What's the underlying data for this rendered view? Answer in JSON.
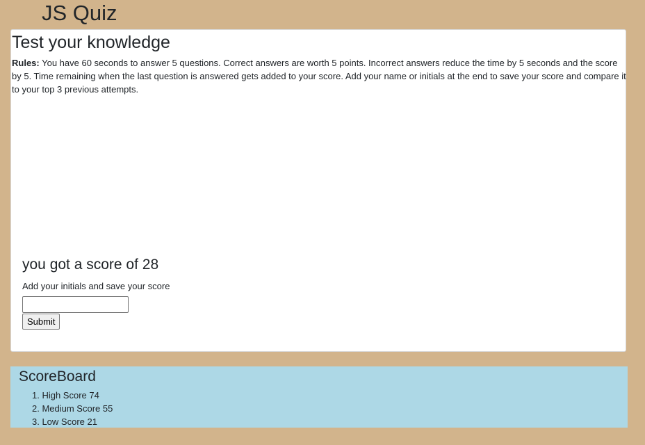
{
  "app": {
    "title": "JS Quiz"
  },
  "quiz": {
    "heading": "Test your knowledge",
    "rules_label": "Rules:",
    "rules_text": " You have 60 seconds to answer 5 questions. Correct answers are worth 5 points. Incorrect answers reduce the time by 5 seconds and the score by 5. Time remaining when the last question is answered gets added to your score. Add your name or initials at the end to save your score and compare it to your top 3 previous attempts."
  },
  "result": {
    "score_text": "you got a score of 28",
    "initials_label": "Add your initials and save your score",
    "initials_value": "",
    "submit_label": "Submit"
  },
  "scoreboard": {
    "title": "ScoreBoard",
    "entries": [
      "1. High Score 74",
      "2. Medium Score 55",
      "3. Low Score 21"
    ]
  },
  "colors": {
    "page_background": "#d2b48c",
    "card_background": "#ffffff",
    "scoreboard_background": "#add8e6"
  }
}
